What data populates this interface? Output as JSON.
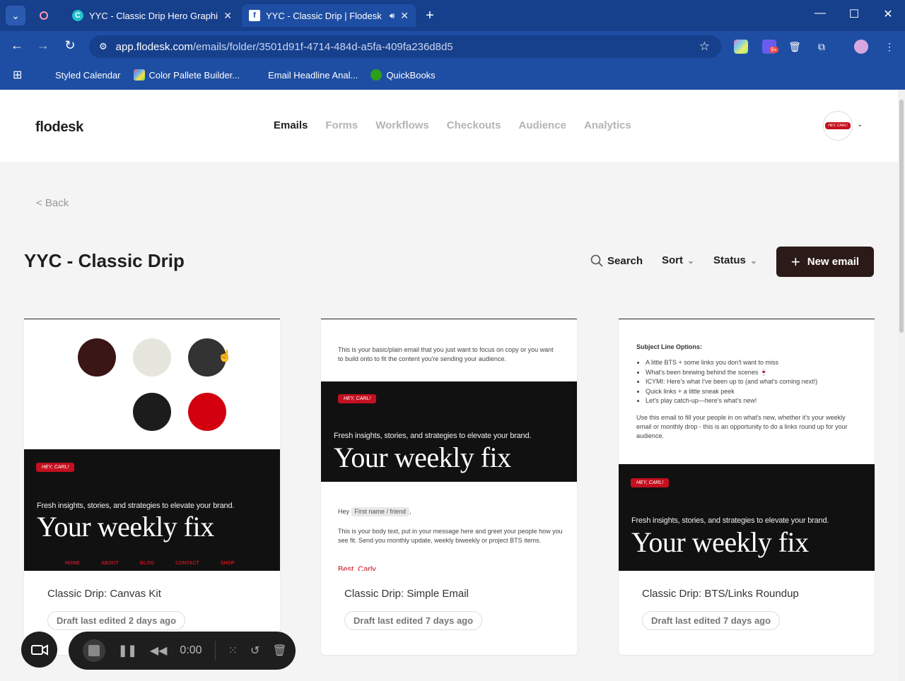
{
  "browser": {
    "tabs": [
      {
        "title": "YYC - Classic Drip Hero Graphic",
        "favicon": "canva-icon",
        "active": false
      },
      {
        "title": "YYC - Classic Drip | Flodesk",
        "favicon": "f",
        "active": true
      }
    ],
    "url_host": "app.flodesk.com",
    "url_path": "/emails/folder/3501d91f-4714-484d-a5fa-409fa236d8d5",
    "extension_badge": "9+",
    "bookmarks": [
      "Styled Calendar",
      "Color Pallete Builder...",
      "Email Headline Anal...",
      "QuickBooks"
    ]
  },
  "app": {
    "logo": "flodesk",
    "nav": [
      "Emails",
      "Forms",
      "Workflows",
      "Checkouts",
      "Audience",
      "Analytics"
    ],
    "active_nav": "Emails",
    "avatar_text": "HEY, CARL!"
  },
  "page": {
    "back_label": "< Back",
    "title": "YYC - Classic Drip",
    "search_label": "Search",
    "sort_label": "Sort",
    "status_label": "Status",
    "new_email_label": "New email"
  },
  "cards": [
    {
      "name": "Classic Drip: Canvas Kit",
      "status": "Draft last edited 2 days ago",
      "palette": [
        "#3a1616",
        "#e6e6dc",
        "#333333",
        "#1c1c1c",
        "#d3000f"
      ],
      "hey": "HEY, CARL!",
      "tagline": "Fresh insights, stories, and strategies to elevate your brand.",
      "headline": "Your weekly fix",
      "links": [
        "HOME",
        "ABOUT",
        "BLOG",
        "CONTACT",
        "SHOP"
      ]
    },
    {
      "name": "Classic Drip: Simple Email",
      "status": "Draft last edited 7 days ago",
      "intro": "This is your basic/plain email that you just want to focus on copy or you want to build onto to fit the content you're sending your audience.",
      "hey": "HEY, CARL!",
      "tagline": "Fresh insights, stories, and strategies to elevate your brand.",
      "headline": "Your weekly fix",
      "greeting": "Hey",
      "merge_tag": "First name / friend",
      "body": "This is your body text, put in your message here and greet your people how you see fit. Send you monthly update, weekly biweekly or project BTS items.",
      "signoff": "Best, Carly"
    },
    {
      "name": "Classic Drip: BTS/Links Roundup",
      "status": "Draft last edited 7 days ago",
      "subject_title": "Subject Line Options:",
      "subject_options": [
        "A little BTS + some links you don't want to miss",
        "What's been brewing behind the scenes 🍷",
        "ICYMI: Here's what I've been up to (and what's coming next!)",
        "Quick links + a little sneak peek",
        "Let's play catch-up—here's what's new!"
      ],
      "body": "Use this email to fill your people in on what's new, whether it's your weekly email or monthly drop - this is an opportunity to do a links round up for your audience.",
      "hey": "HEY, CARL!",
      "tagline": "Fresh insights, stories, and strategies to elevate your brand.",
      "headline": "Your weekly fix"
    }
  ],
  "recorder": {
    "time": "0:00"
  }
}
